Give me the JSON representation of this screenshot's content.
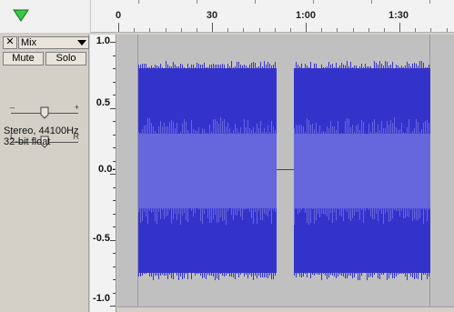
{
  "ruler": {
    "labels": [
      "0",
      "30",
      "1:00",
      "1:30"
    ]
  },
  "track": {
    "name": "Mix",
    "close_label": "✕",
    "mute_label": "Mute",
    "solo_label": "Solo",
    "gain_minus": "–",
    "gain_plus": "+",
    "pan_left": "L",
    "pan_right": "R",
    "format_line1": "Stereo, 44100Hz",
    "format_line2": "32-bit float",
    "gain_level": 0.5,
    "pan_level": 0.5
  },
  "amplitude_ruler": {
    "labels": [
      "1.0",
      "0.5",
      "0.0-",
      "-0.5",
      "-1.0"
    ]
  },
  "colors": {
    "waveform": "#3333cc",
    "waveform_rms": "#6666dd",
    "background": "#c0c0c0"
  }
}
